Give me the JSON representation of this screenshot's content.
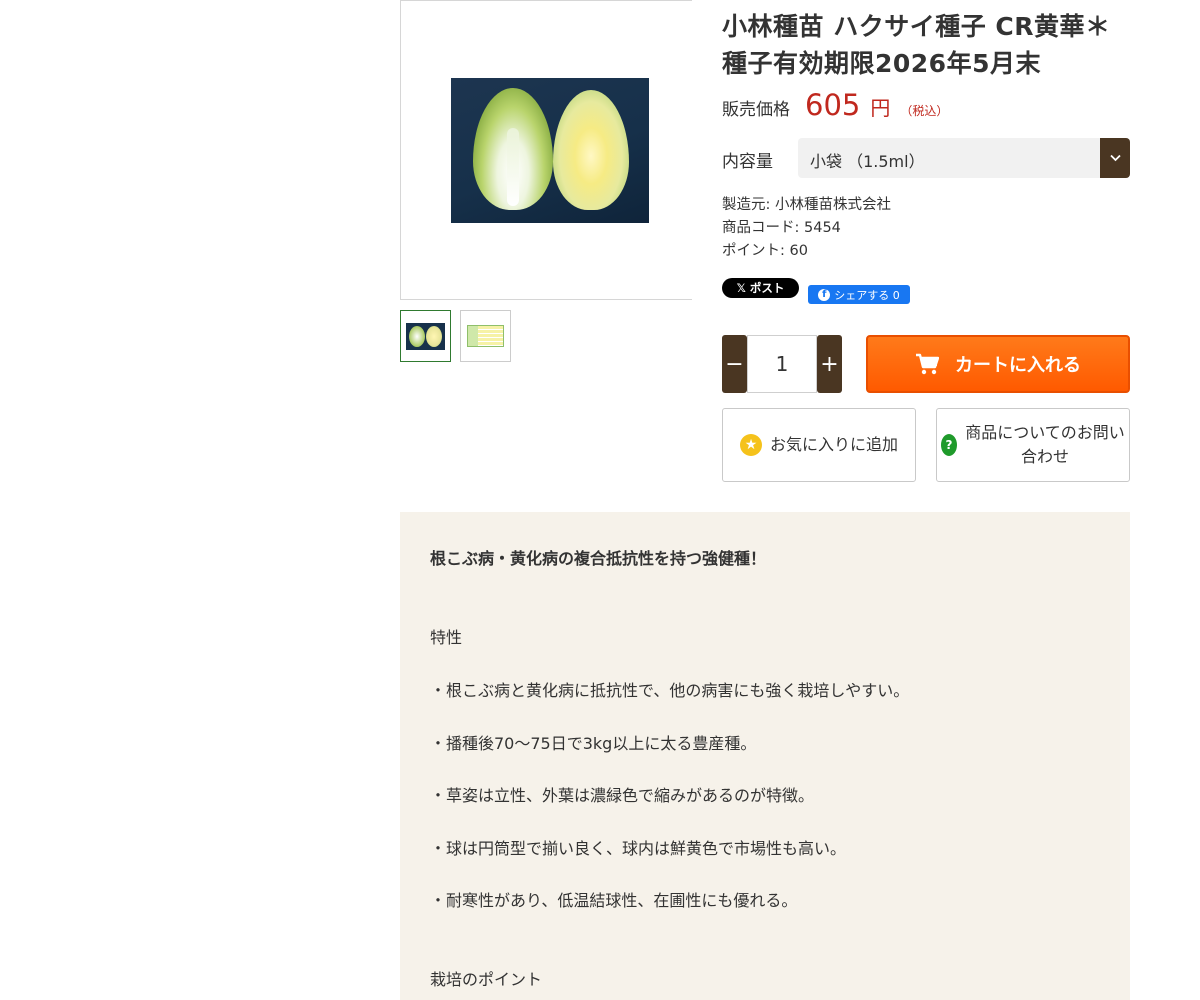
{
  "product": {
    "title_line1": "小林種苗 ハクサイ種子 CR黄華＊",
    "title_line2": "種子有効期限2026年5月末",
    "price_label": "販売価格",
    "price_value": "605",
    "price_unit": "円",
    "price_tax": "（税込）",
    "option_label": "内容量",
    "option_selected": "小袋 （1.5ml）",
    "maker": "製造元: 小林種苗株式会社",
    "code": "商品コード: 5454",
    "points": "ポイント: 60"
  },
  "social": {
    "x_label": "ポスト",
    "fb_label": "シェアする 0"
  },
  "purchase": {
    "quantity": "1",
    "minus": "−",
    "plus": "+",
    "cart_label": "カートに入れる",
    "favorite_label": "お気に入りに追加",
    "inquiry_label": "商品についてのお問い合わせ"
  },
  "description": {
    "lead": "根こぶ病・黄化病の複合抵抗性を持つ強健種！",
    "heading_features": "特性",
    "features": [
      "・根こぶ病と黄化病に抵抗性で、他の病害にも強く栽培しやすい。",
      "・播種後70〜75日で3kg以上に太る豊産種。",
      "・草姿は立性、外葉は濃緑色で縮みがあるのが特徴。",
      "・球は円筒型で揃い良く、球内は鮮黄色で市場性も高い。",
      "・耐寒性があり、低温結球性、在圃性にも優れる。"
    ],
    "heading_points": "栽培のポイント"
  },
  "colors": {
    "price_red": "#c0281e",
    "brown": "#4a3622",
    "cart_orange": "#ff6a00",
    "desc_bg": "#f6f2ea"
  },
  "icons": [
    "cabbage-photo",
    "cart-icon",
    "star-icon",
    "question-icon",
    "chevron-down-icon",
    "x-logo-icon",
    "facebook-icon"
  ]
}
